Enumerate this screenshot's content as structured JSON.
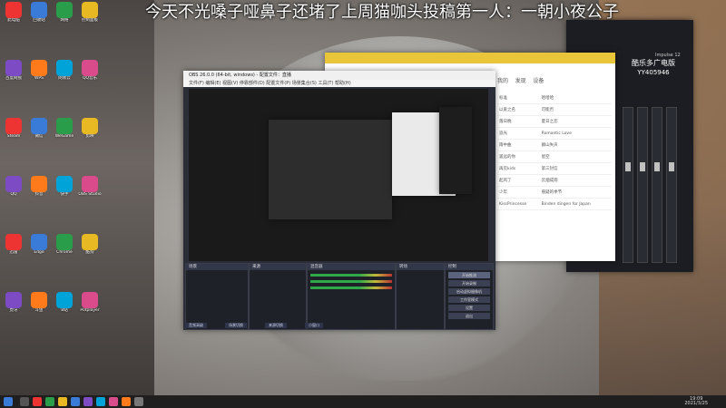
{
  "banner": {
    "text": "今天不光嗓子哑鼻子还堵了上周猫咖头投稿第一人：一朝小夜公子"
  },
  "desktop_icons": [
    "此电脑",
    "回收站",
    "网络",
    "控制面板",
    "百度网盘",
    "WPS",
    "网易云",
    "QQ音乐",
    "Steam",
    "微信",
    "WeGame",
    "剪映",
    "QQ",
    "抖音",
    "快手",
    "OBS Studio",
    "迅雷",
    "Edge",
    "Chrome",
    "酷狗",
    "虎牙",
    "斗鱼",
    "B站",
    "Potplayer"
  ],
  "obs": {
    "title": "OBS 26.0.0 (64-bit, windows) - 配置文件：直播",
    "menu": "文件(F)  编辑(E)  视图(V)  停靠部件(D)  配置文件(P)  场景集合(S)  工具(T)  帮助(H)",
    "docks": {
      "scenes": "场景",
      "sources": "来源",
      "mixer": "混音器",
      "transitions": "转场",
      "controls": "控制"
    },
    "controls": [
      "开始推流",
      "开始录制",
      "启动虚拟摄像机",
      "工作室模式",
      "设置",
      "退出"
    ],
    "tabs": [
      "音频高级",
      "场景切换",
      "来源切换",
      "小窗口"
    ]
  },
  "music": {
    "nav_1": "我的",
    "nav_2": "发现",
    "nav_3": "设备",
    "rows": [
      [
        "标准",
        "哈哈哈"
      ],
      [
        "以爱之名",
        "可能否"
      ],
      [
        "落日晚",
        "夏日之恋"
      ],
      [
        "追光",
        "Romantic Love"
      ],
      [
        "雨中曲",
        "群山失声"
      ],
      [
        "遥远的你",
        "星空"
      ],
      [
        "再见kids",
        "第三封信"
      ],
      [
        "起风了",
        "云烟成雨"
      ],
      [
        "少年",
        "悬疑的季节"
      ],
      [
        "KissPrincesse",
        "Binden dingen for Japan"
      ]
    ]
  },
  "mixer": {
    "brand": "酷乐多广电版",
    "code": "YY405946",
    "model": "Impulse 12"
  },
  "taskbar": {
    "time": "19:09",
    "date": "2021/3/25"
  }
}
